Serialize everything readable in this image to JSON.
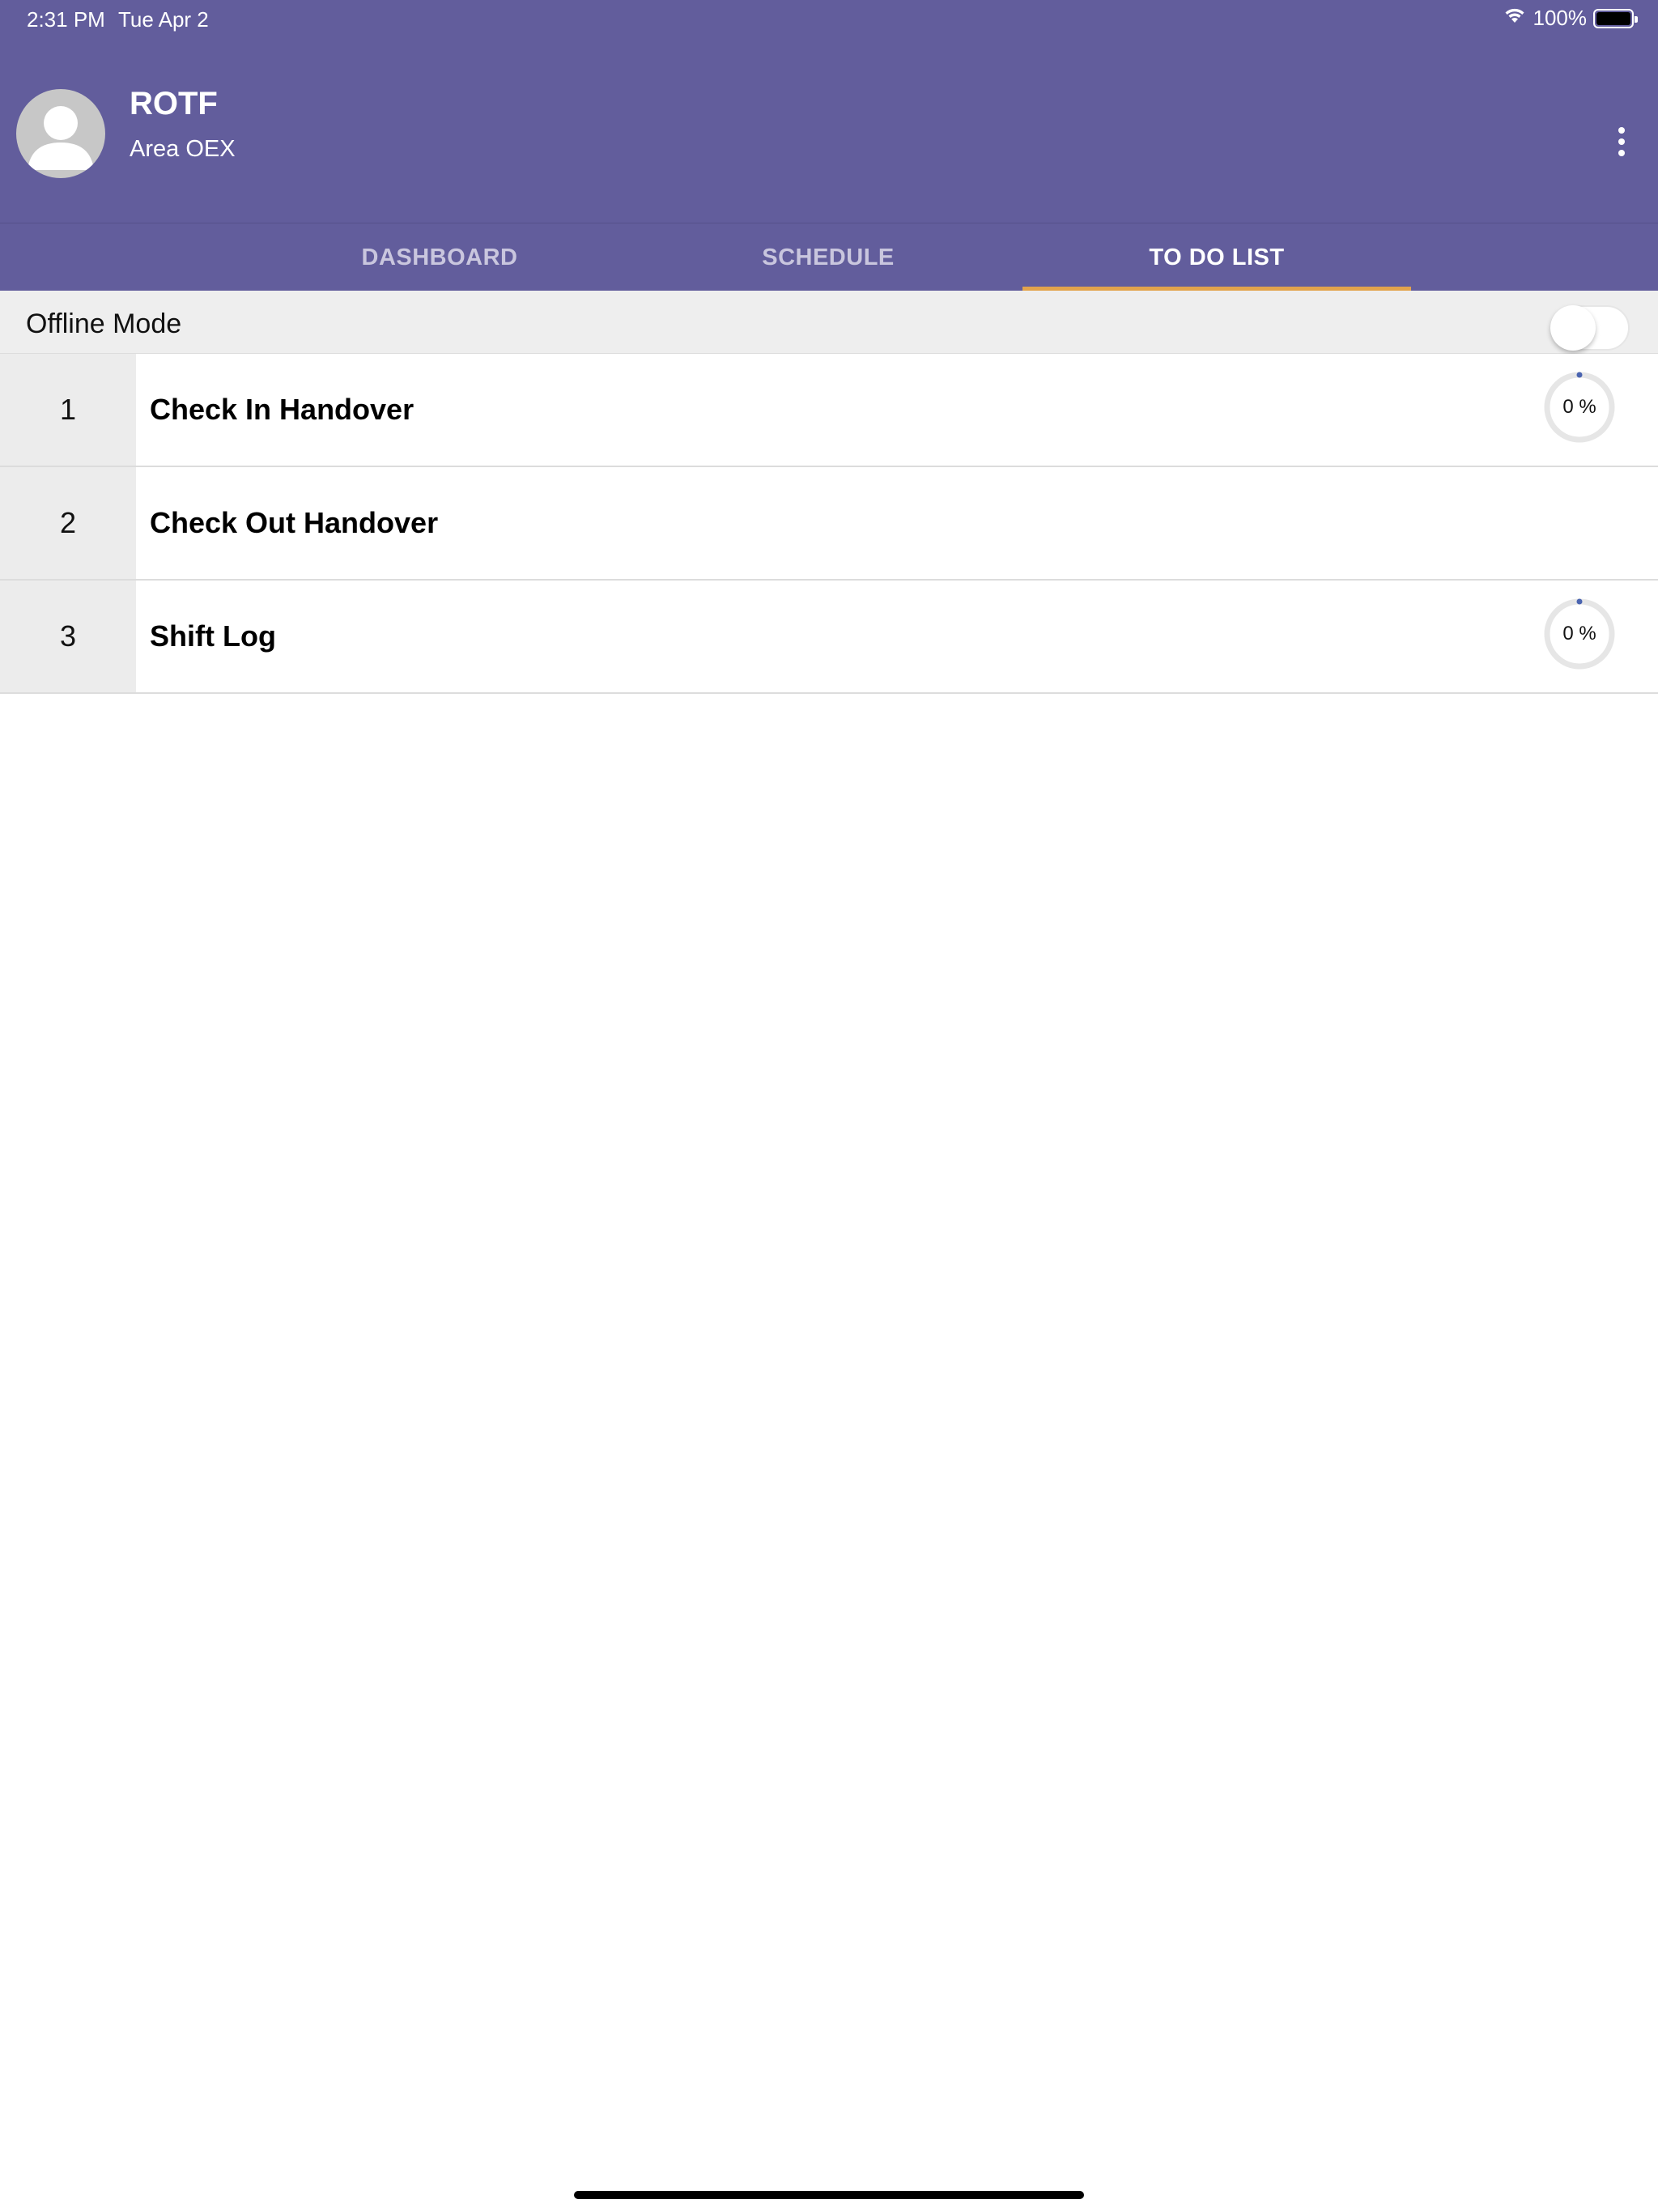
{
  "status_bar": {
    "time": "2:31 PM",
    "date": "Tue Apr 2",
    "battery": "100%",
    "battery_level": 1.0
  },
  "header": {
    "user_name": "ROTF",
    "area": "Area OEX",
    "avatar_icon": "person-icon",
    "menu_icon": "more-vertical-icon"
  },
  "tabs": [
    {
      "label": "DASHBOARD",
      "active": false
    },
    {
      "label": "SCHEDULE",
      "active": false
    },
    {
      "label": "TO DO LIST",
      "active": true
    }
  ],
  "offline_mode": {
    "label": "Offline Mode",
    "enabled": false
  },
  "todo_items": [
    {
      "number": "1",
      "title": "Check In Handover",
      "progress_label": "0 %",
      "progress": 0,
      "show_progress": true
    },
    {
      "number": "2",
      "title": "Check Out Handover",
      "progress_label": "",
      "progress": null,
      "show_progress": false
    },
    {
      "number": "3",
      "title": "Shift Log",
      "progress_label": "0 %",
      "progress": 0,
      "show_progress": true
    }
  ],
  "colors": {
    "header": "#625d9c",
    "tab_indicator": "#e2a34c",
    "progress_track": "#e6e6e6",
    "progress_dot": "#4a64b0"
  }
}
